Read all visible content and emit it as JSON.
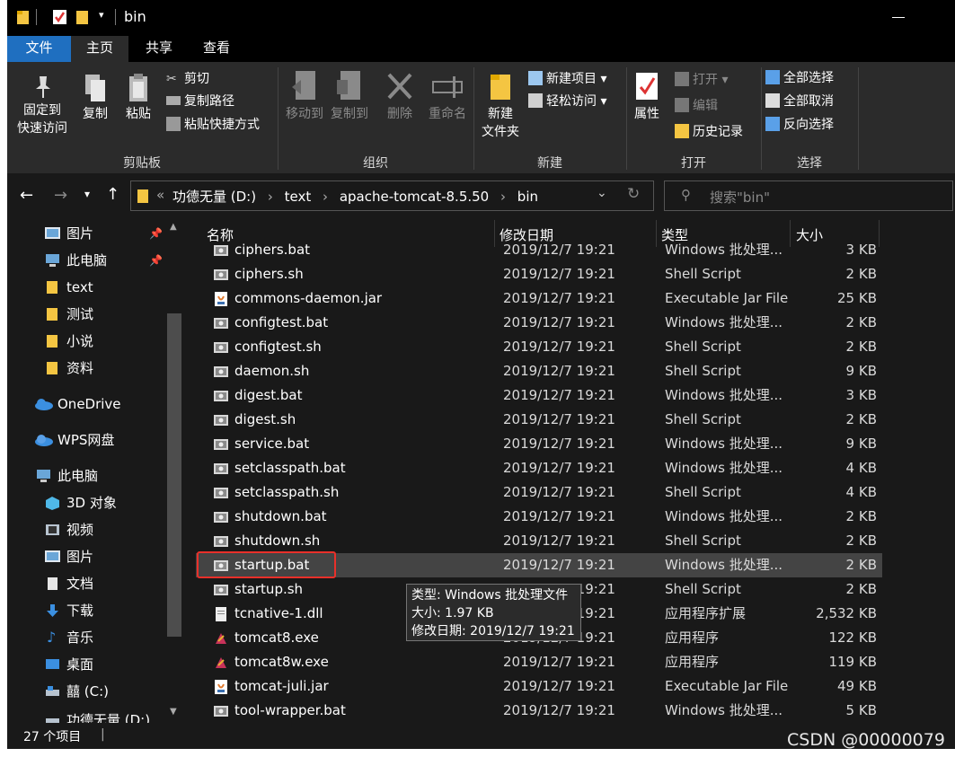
{
  "window": {
    "title": "bin"
  },
  "tabs": [
    "文件",
    "主页",
    "共享",
    "查看"
  ],
  "ribbon": {
    "pin": "固定到",
    "pin2": "快速访问",
    "copy": "复制",
    "paste": "粘贴",
    "cut": "剪切",
    "copy_path": "复制路径",
    "paste_shortcut": "粘贴快捷方式",
    "move_to": "移动到",
    "copy_to": "复制到",
    "delete": "删除",
    "rename": "重命名",
    "new_folder": "新建",
    "new_folder2": "文件夹",
    "new_item": "新建项目",
    "easy_access": "轻松访问",
    "properties": "属性",
    "open": "打开",
    "edit": "编辑",
    "history": "历史记录",
    "select_all": "全部选择",
    "select_none": "全部取消",
    "invert": "反向选择",
    "groups": [
      "剪贴板",
      "组织",
      "新建",
      "打开",
      "选择"
    ]
  },
  "address": {
    "prefix": "«",
    "crumbs": [
      "功德无量 (D:)",
      "text",
      "apache-tomcat-8.5.50",
      "bin"
    ],
    "search_placeholder": "搜索\"bin\""
  },
  "nav": {
    "items": [
      "图片",
      "此电脑",
      "text",
      "测试",
      "小说",
      "资料",
      "OneDrive",
      "WPS网盘",
      "此电脑",
      "3D 对象",
      "视频",
      "图片",
      "文档",
      "下载",
      "音乐",
      "桌面",
      "囍 (C:)",
      "功德无量 (D:)"
    ]
  },
  "columns": {
    "name": "名称",
    "date": "修改日期",
    "type": "类型",
    "size": "大小"
  },
  "files": [
    {
      "name": "ciphers.bat",
      "date": "2019/12/7 19:21",
      "type": "Windows 批处理...",
      "size": "3 KB"
    },
    {
      "name": "ciphers.sh",
      "date": "2019/12/7 19:21",
      "type": "Shell Script",
      "size": "2 KB"
    },
    {
      "name": "commons-daemon.jar",
      "date": "2019/12/7 19:21",
      "type": "Executable Jar File",
      "size": "25 KB"
    },
    {
      "name": "configtest.bat",
      "date": "2019/12/7 19:21",
      "type": "Windows 批处理...",
      "size": "2 KB"
    },
    {
      "name": "configtest.sh",
      "date": "2019/12/7 19:21",
      "type": "Shell Script",
      "size": "2 KB"
    },
    {
      "name": "daemon.sh",
      "date": "2019/12/7 19:21",
      "type": "Shell Script",
      "size": "9 KB"
    },
    {
      "name": "digest.bat",
      "date": "2019/12/7 19:21",
      "type": "Windows 批处理...",
      "size": "3 KB"
    },
    {
      "name": "digest.sh",
      "date": "2019/12/7 19:21",
      "type": "Shell Script",
      "size": "2 KB"
    },
    {
      "name": "service.bat",
      "date": "2019/12/7 19:21",
      "type": "Windows 批处理...",
      "size": "9 KB"
    },
    {
      "name": "setclasspath.bat",
      "date": "2019/12/7 19:21",
      "type": "Windows 批处理...",
      "size": "4 KB"
    },
    {
      "name": "setclasspath.sh",
      "date": "2019/12/7 19:21",
      "type": "Shell Script",
      "size": "4 KB"
    },
    {
      "name": "shutdown.bat",
      "date": "2019/12/7 19:21",
      "type": "Windows 批处理...",
      "size": "2 KB"
    },
    {
      "name": "shutdown.sh",
      "date": "2019/12/7 19:21",
      "type": "Shell Script",
      "size": "2 KB"
    },
    {
      "name": "startup.bat",
      "date": "2019/12/7 19:21",
      "type": "Windows 批处理...",
      "size": "2 KB"
    },
    {
      "name": "startup.sh",
      "date": "2019/12/7 19:21",
      "type": "Shell Script",
      "size": "2 KB"
    },
    {
      "name": "tcnative-1.dll",
      "date": "2019/12/7 19:21",
      "type": "应用程序扩展",
      "size": "2,532 KB"
    },
    {
      "name": "tomcat8.exe",
      "date": "2019/12/7 19:21",
      "type": "应用程序",
      "size": "122 KB"
    },
    {
      "name": "tomcat8w.exe",
      "date": "2019/12/7 19:21",
      "type": "应用程序",
      "size": "119 KB"
    },
    {
      "name": "tomcat-juli.jar",
      "date": "2019/12/7 19:21",
      "type": "Executable Jar File",
      "size": "49 KB"
    },
    {
      "name": "tool-wrapper.bat",
      "date": "2019/12/7 19:21",
      "type": "Windows 批处理...",
      "size": "5 KB"
    }
  ],
  "tooltip": {
    "type": "类型: Windows 批处理文件",
    "size": "大小: 1.97 KB",
    "date": "修改日期: 2019/12/7 19:21"
  },
  "status": {
    "count": "27 个项目"
  },
  "watermark": "CSDN @00000079"
}
